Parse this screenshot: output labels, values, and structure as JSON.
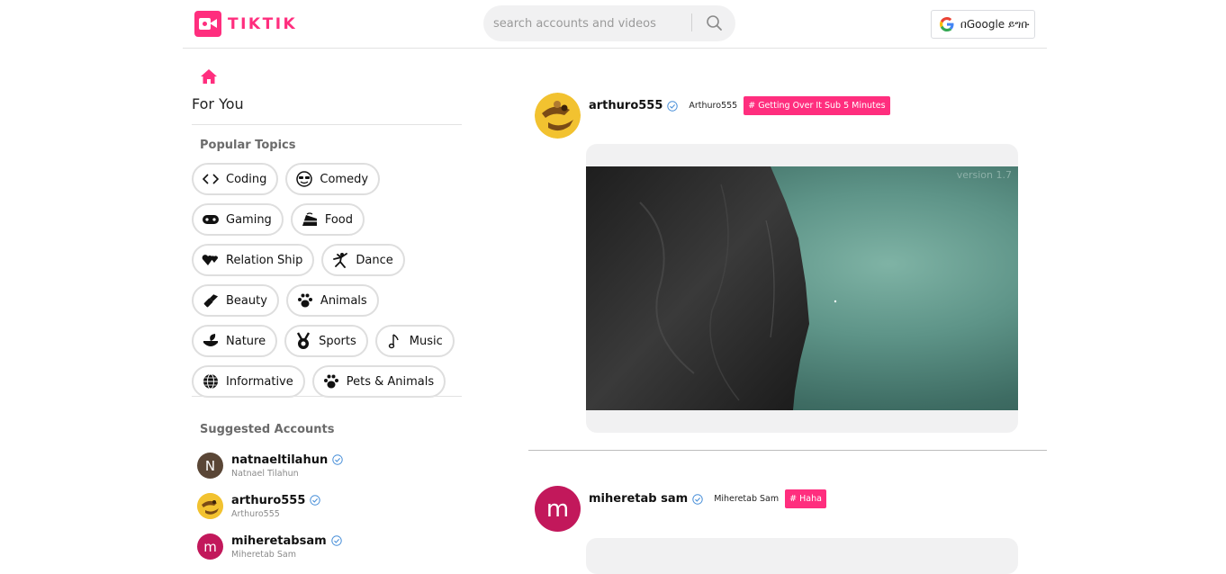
{
  "header": {
    "logo_text": "TIKTIK",
    "search_placeholder": "search accounts and videos",
    "google_button_label": "በGoogle ይግቡ"
  },
  "sidebar": {
    "for_you_label": "For You",
    "popular_topics_title": "Popular Topics",
    "topics": [
      {
        "label": "Coding",
        "icon": "code-icon"
      },
      {
        "label": "Comedy",
        "icon": "sunglasses-emoji-icon"
      },
      {
        "label": "Gaming",
        "icon": "gamepad-icon"
      },
      {
        "label": "Food",
        "icon": "cake-icon"
      },
      {
        "label": "Relation Ship",
        "icon": "hearts-icon"
      },
      {
        "label": "Dance",
        "icon": "dance-icon"
      },
      {
        "label": "Beauty",
        "icon": "lipstick-icon"
      },
      {
        "label": "Animals",
        "icon": "paw-icon"
      },
      {
        "label": "Nature",
        "icon": "leaf-icon"
      },
      {
        "label": "Sports",
        "icon": "medal-icon"
      },
      {
        "label": "Music",
        "icon": "music-note-icon"
      },
      {
        "label": "Informative",
        "icon": "globe-icon"
      },
      {
        "label": "Pets & Animals",
        "icon": "paw-icon"
      }
    ],
    "suggested_title": "Suggested Accounts",
    "accounts": [
      {
        "username": "natnaeltilahun",
        "display_name": "Natnael Tilahun",
        "initial": "N",
        "avatar_color": "#5a4636"
      },
      {
        "username": "arthuro555",
        "display_name": "Arthuro555",
        "initial": "",
        "avatar_color": "#f2c230"
      },
      {
        "username": "miheretabsam",
        "display_name": "Miheretab Sam",
        "initial": "m",
        "avatar_color": "#c2185b"
      }
    ]
  },
  "feed": {
    "posts": [
      {
        "username": "arthuro555",
        "display_name": "Arthuro555",
        "topic": "# Getting Over It Sub 5 Minutes",
        "video_overlay": "version 1.7"
      },
      {
        "username": "miheretab sam",
        "display_name": "Miheretab Sam",
        "topic": "# Haha",
        "initial": "m",
        "avatar_color": "#c2185b"
      }
    ]
  },
  "colors": {
    "accent": "#ff2e7e",
    "verified": "#4a90d9",
    "chip_border": "#dedede"
  }
}
